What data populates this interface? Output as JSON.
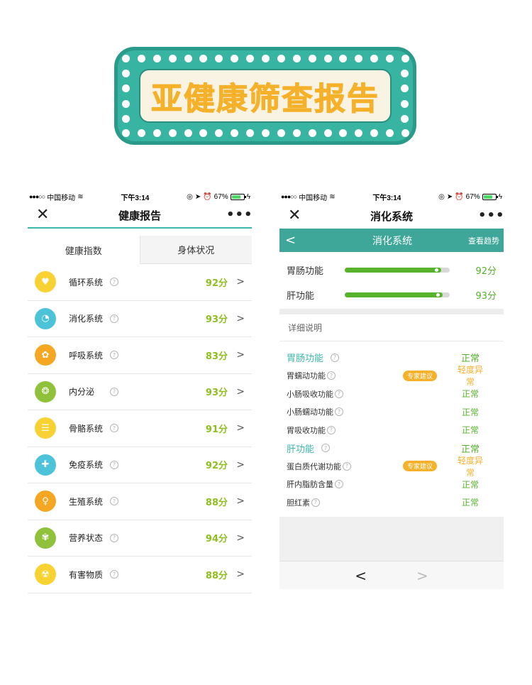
{
  "banner": {
    "title": "亚健康筛查报告"
  },
  "colors": {
    "accent": "#3bb8a8",
    "score_green": "#8fbf1f",
    "normal_green": "#57b22c",
    "warning": "#f5b12a",
    "banner_teal": "#38b5a2"
  },
  "status_bar": {
    "carrier": "中国移动",
    "time": "下午3:14",
    "battery": "67%"
  },
  "left_screen": {
    "nav_title": "健康报告",
    "tabs": [
      "健康指数",
      "身体状况"
    ],
    "items": [
      {
        "label": "循环系统",
        "score": "92分",
        "icon": "heart-organ-icon",
        "color": "#f7d232"
      },
      {
        "label": "消化系统",
        "score": "93分",
        "icon": "stomach-icon",
        "color": "#4cc3d9"
      },
      {
        "label": "呼吸系统",
        "score": "83分",
        "icon": "lungs-icon",
        "color": "#f5a623"
      },
      {
        "label": "内分泌",
        "score": "93分",
        "icon": "brain-icon",
        "color": "#8fc23a"
      },
      {
        "label": "骨骼系统",
        "score": "91分",
        "icon": "ribcage-icon",
        "color": "#f7d232"
      },
      {
        "label": "免疫系统",
        "score": "92分",
        "icon": "first-aid-icon",
        "color": "#4cc3d9"
      },
      {
        "label": "生殖系统",
        "score": "88分",
        "icon": "uterus-icon",
        "color": "#f5a623"
      },
      {
        "label": "营养状态",
        "score": "94分",
        "icon": "nutrition-icon",
        "color": "#8fc23a"
      },
      {
        "label": "有害物质",
        "score": "88分",
        "icon": "hazard-icon",
        "color": "#f7d232"
      }
    ]
  },
  "right_screen": {
    "nav_title": "消化系统",
    "sub_title": "消化系统",
    "trend_label": "查看趋势",
    "progress": [
      {
        "label": "胃肠功能",
        "score": "92分",
        "value": 0.92
      },
      {
        "label": "肝功能",
        "score": "93分",
        "value": 0.93
      }
    ],
    "detail_header": "详细说明",
    "badge_label": "专家建议",
    "details": [
      {
        "label": "胃肠功能",
        "status": "正常",
        "group": true
      },
      {
        "label": "胃蠕动功能",
        "status": "轻度异常",
        "badge": true
      },
      {
        "label": "小肠吸收功能",
        "status": "正常"
      },
      {
        "label": "小肠蠕动功能",
        "status": "正常"
      },
      {
        "label": "胃吸收功能",
        "status": "正常"
      },
      {
        "label": "肝功能",
        "status": "正常",
        "group": true
      },
      {
        "label": "蛋白质代谢功能",
        "status": "轻度异常",
        "badge": true
      },
      {
        "label": "肝内脂肪含量",
        "status": "正常"
      },
      {
        "label": "胆红素",
        "status": "正常"
      }
    ]
  }
}
